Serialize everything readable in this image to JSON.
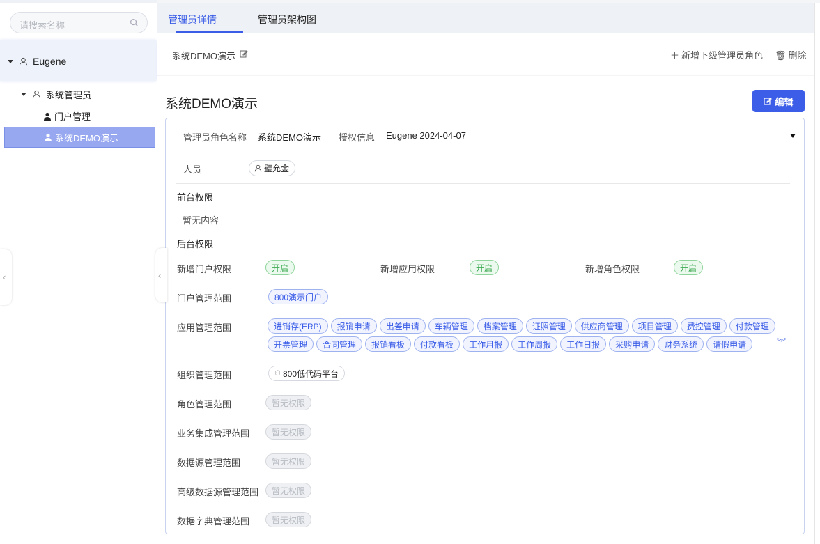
{
  "search": {
    "placeholder": "请搜索名称"
  },
  "tree": {
    "root": "Eugene",
    "group": "系统管理员",
    "items": [
      "门户管理",
      "系统DEMO演示"
    ]
  },
  "tabs": [
    "管理员详情",
    "管理员架构图"
  ],
  "header": {
    "title": "系统DEMO演示",
    "add": "新增下级管理员角色",
    "delete": "删除"
  },
  "page": {
    "title": "系统DEMO演示",
    "edit": "编辑"
  },
  "card": {
    "role_label": "管理员角色名称",
    "role_value": "系统DEMO演示",
    "auth_label": "授权信息",
    "auth_value": "Eugene 2024-04-07",
    "person_label": "人员",
    "person_value": "璧允金",
    "front_title": "前台权限",
    "front_empty": "暂无内容",
    "back_title": "后台权限",
    "perm1_label": "新增门户权限",
    "perm1_val": "开启",
    "perm2_label": "新增应用权限",
    "perm2_val": "开启",
    "perm3_label": "新增角色权限",
    "perm3_val": "开启",
    "portal_label": "门户管理范围",
    "portal_val": "800演示门户",
    "app_label": "应用管理范围",
    "apps_row1": [
      "进销存(ERP)",
      "报销申请",
      "出差申请",
      "车辆管理",
      "档案管理",
      "证照管理",
      "供应商管理",
      "项目管理",
      "费控管理",
      "付款管理"
    ],
    "apps_row2": [
      "开票管理",
      "合同管理",
      "报销看板",
      "付款看板",
      "工作月报",
      "工作周报",
      "工作日报",
      "采购申请",
      "财务系统",
      "请假申请"
    ],
    "org_label": "组织管理范围",
    "org_val": "800低代码平台",
    "role_scope_label": "角色管理范围",
    "biz_label": "业务集成管理范围",
    "ds_label": "数据源管理范围",
    "adv_ds_label": "高级数据源管理范围",
    "dict_label": "数据字典管理范围",
    "none": "暂无权限"
  }
}
